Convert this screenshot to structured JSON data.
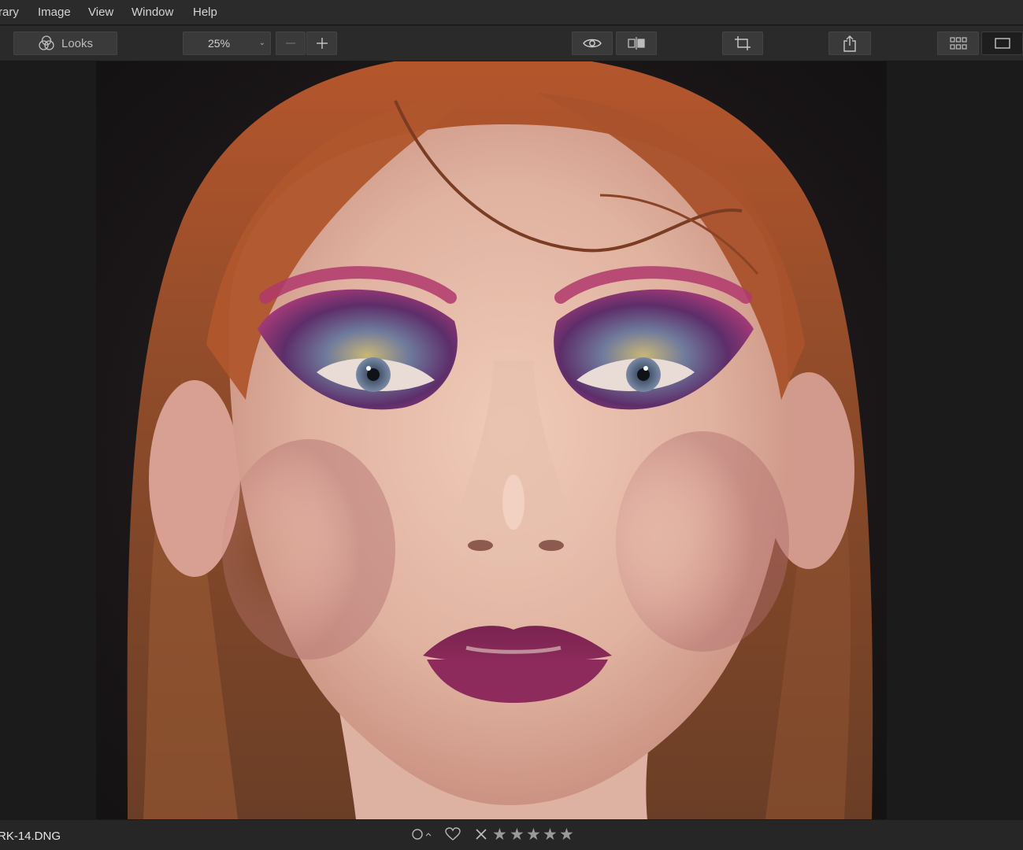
{
  "menu": {
    "items": [
      {
        "label": "rary"
      },
      {
        "label": "Image"
      },
      {
        "label": "View"
      },
      {
        "label": "Window"
      },
      {
        "label": "Help"
      }
    ]
  },
  "toolbar": {
    "looks_label": "Looks",
    "zoom_value": "25%",
    "zoom_out_icon": "minus-icon",
    "zoom_in_icon": "plus-icon",
    "preview_icon": "eye-icon",
    "compare_icon": "split-compare-icon",
    "crop_icon": "crop-icon",
    "share_icon": "share-icon",
    "grid_view_icon": "grid-icon",
    "single_view_icon": "single-view-icon",
    "single_view_active": true
  },
  "image": {
    "description_icon": "photo"
  },
  "status": {
    "filename": "RK-14.DNG",
    "color_label_icon": "circle-icon",
    "favorite_icon": "heart-icon",
    "reject_icon": "x-icon",
    "rating_stars_total": 5,
    "rating_value": 0
  },
  "colors": {
    "menubar": "#2b2b2b",
    "toolbar": "#2a2a2a",
    "button": "#3a3a3a",
    "canvas": "#1b1b1b",
    "statusbar": "#262626"
  }
}
